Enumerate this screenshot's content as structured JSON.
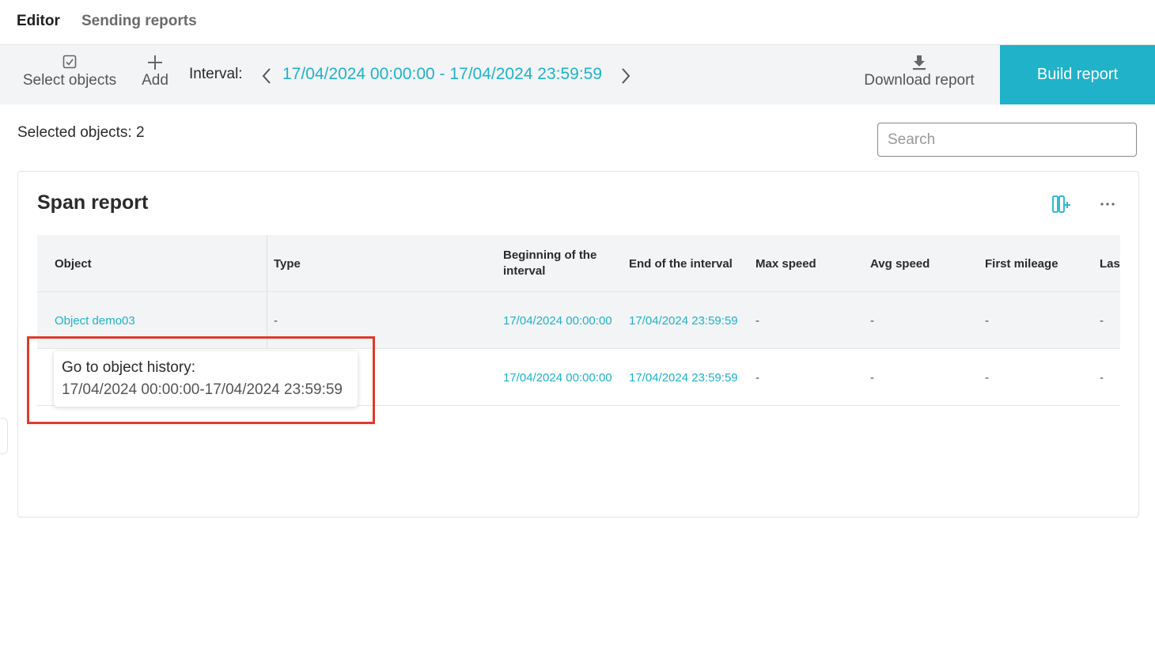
{
  "tabs": {
    "editor": "Editor",
    "sending": "Sending reports"
  },
  "toolbar": {
    "select_objects": "Select objects",
    "add": "Add",
    "interval_label": "Interval:",
    "interval_value": "17/04/2024 00:00:00 - 17/04/2024 23:59:59",
    "download_report": "Download report",
    "build_report": "Build report"
  },
  "selected_objects": "Selected objects: 2",
  "search": {
    "placeholder": "Search",
    "value": ""
  },
  "report": {
    "title": "Span report",
    "columns": [
      "Object",
      "Type",
      "Beginning of the interval",
      "End of the interval",
      "Max speed",
      "Avg speed",
      "First mileage",
      "Last"
    ],
    "rows": [
      [
        "Object demo03",
        "-",
        "17/04/2024 00:00:00",
        "17/04/2024 23:59:59",
        "-",
        "-",
        "-",
        "-"
      ],
      [
        "",
        "",
        "17/04/2024 00:00:00",
        "17/04/2024 23:59:59",
        "-",
        "-",
        "-",
        "-"
      ]
    ]
  },
  "tooltip": {
    "line1": "Go to object history:",
    "line2": "17/04/2024 00:00:00-17/04/2024 23:59:59"
  },
  "colors": {
    "accent": "#1fb2c9",
    "highlight": "#e03a2a",
    "toolbar_bg": "#f3f4f6"
  }
}
